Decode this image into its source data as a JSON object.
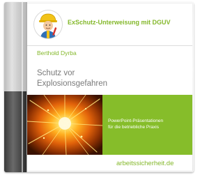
{
  "cover": {
    "series_title": "ExSchutz-Unterweisung mit DGUV",
    "author": "Berthold Dyrba",
    "title_line1": "Schutz vor",
    "title_line2": "Explosionsgefahren",
    "panel_line1": "PowerPoint-Präsentationen",
    "panel_line2": "für die betriebliche Praxis",
    "website": "arbeitssicherheit.de"
  },
  "colors": {
    "brand_green": "#84b82b",
    "panel_green": "#86bd2a",
    "title_gray": "#7a7a7a",
    "explosion_core": "#fff6c8",
    "explosion_outer": "#6a2400"
  },
  "icons": {
    "logo": "safety-worker-mascot-icon",
    "artwork": "explosion-burst-image"
  }
}
